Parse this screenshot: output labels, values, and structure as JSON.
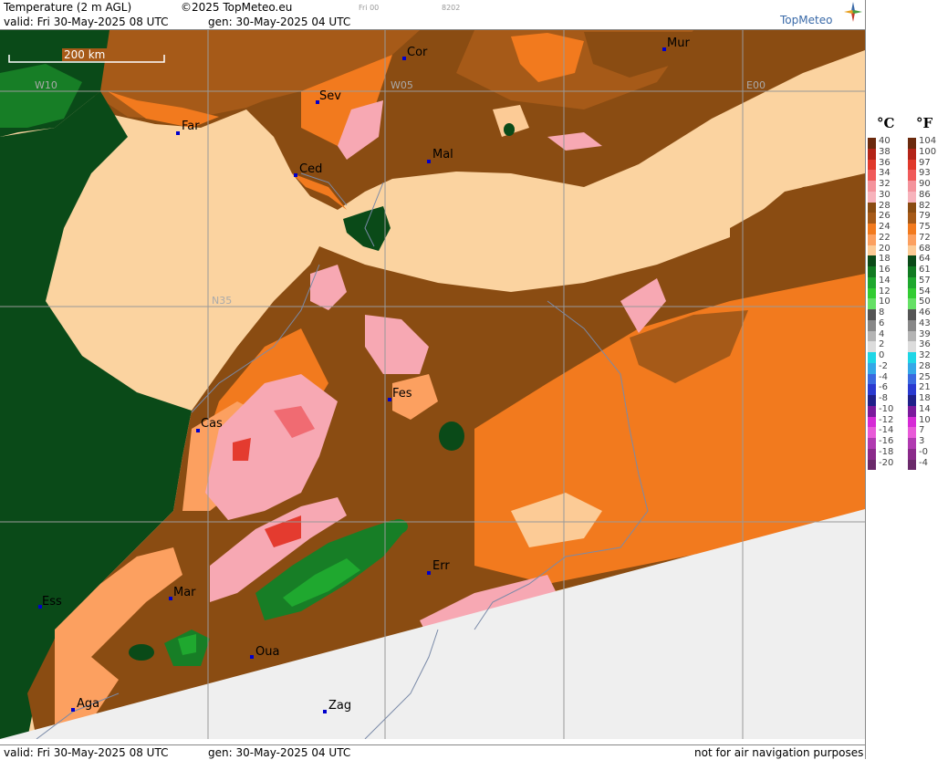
{
  "header": {
    "title": "Temperature (2 m AGL)",
    "copyright": "©2025 TopMeteo.eu",
    "tab": "Fri 00",
    "code": "8202",
    "valid": "valid:  Fri   30-May-2025  08 UTC",
    "gen": "gen:  30-May-2025 04 UTC",
    "brand": "TopMeteo"
  },
  "map": {
    "scale": "200 km",
    "grid_labels": [
      "W10",
      "W05",
      "E00",
      "N35"
    ],
    "cities": [
      "Cor",
      "Mur",
      "Sev",
      "Far",
      "Mal",
      "Ced",
      "Fes",
      "Cas",
      "Err",
      "Mar",
      "Ess",
      "Oua",
      "Aga",
      "Zag"
    ],
    "colors": {
      "sea": "#fbd3a0",
      "no_data": "#efefef",
      "t_28_30": "#8a4c12",
      "t_26_28": "#a65a18",
      "t_24_26": "#f27a1e",
      "t_22_24": "#fca060",
      "t_20_22": "#fccb96",
      "t_18_20": "#0a4a18",
      "t_16_18": "#177e26",
      "t_14_16": "#1fa82f",
      "t_30_32": "#f7a8b3",
      "t_32_34": "#f06b72",
      "t_34_36": "#e43b2f"
    }
  },
  "footer": {
    "valid": "valid:  Fri   30-May-2025   08 UTC",
    "gen": "gen: 30-May-2025 04 UTC",
    "note": "not for air navigation purposes"
  },
  "legend": {
    "unit_c": "°C",
    "unit_f": "°F",
    "celsius": [
      "40",
      "38",
      "36",
      "34",
      "32",
      "30",
      "28",
      "26",
      "24",
      "22",
      "20",
      "18",
      "16",
      "14",
      "12",
      "10",
      "8",
      "6",
      "4",
      "2",
      "0",
      "-2",
      "-4",
      "-6",
      "-8",
      "-10",
      "-12",
      "-14",
      "-16",
      "-18",
      "-20"
    ],
    "fahrenheit": [
      "104",
      "100",
      "97",
      "93",
      "90",
      "86",
      "82",
      "79",
      "75",
      "72",
      "68",
      "64",
      "61",
      "57",
      "54",
      "50",
      "46",
      "43",
      "39",
      "36",
      "32",
      "28",
      "25",
      "21",
      "18",
      "14",
      "10",
      "7",
      "3",
      "-0",
      "-4"
    ],
    "colors": [
      "#6b2a0e",
      "#b32418",
      "#e0392b",
      "#f05a5a",
      "#f4939c",
      "#f7b3bc",
      "#8a4c12",
      "#a65a18",
      "#f27a1e",
      "#fca060",
      "#fccb96",
      "#0a4a18",
      "#117a22",
      "#1fa82f",
      "#33cc33",
      "#66e066",
      "#555555",
      "#888888",
      "#b4b4b4",
      "#dcdcdc",
      "#1fd6e6",
      "#35a8e8",
      "#3a6ae0",
      "#2a3ad0",
      "#20208a",
      "#7a1a9c",
      "#d62ad6",
      "#e85ad8",
      "#b03ab0",
      "#8a2a8a",
      "#6a2a6a"
    ]
  }
}
